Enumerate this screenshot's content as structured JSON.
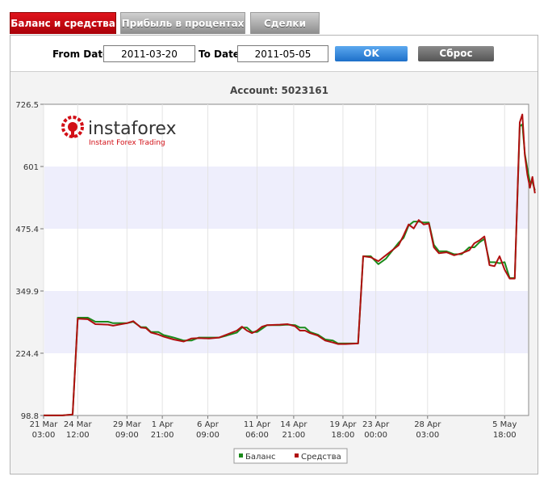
{
  "tabs": [
    {
      "label": "Баланс и средства",
      "active": true
    },
    {
      "label": "Прибыль в процентах",
      "active": false
    },
    {
      "label": "Сделки",
      "active": false
    }
  ],
  "filter": {
    "from_label": "From Date",
    "from_value": "2011-03-20",
    "to_label": "To Date",
    "to_value": "2011-05-05",
    "ok_label": "OK",
    "reset_label": "Сброс"
  },
  "logo": {
    "name": "instaforex",
    "tagline": "Instant Forex Trading"
  },
  "colors": {
    "balance": "#1a8a1a",
    "equity": "#b01010",
    "band": "#eeeefc",
    "accent": "#d20f16"
  },
  "chart_data": {
    "type": "line",
    "title": "Account: 5023161",
    "xlabel": "",
    "ylabel": "",
    "ylim": [
      98.8,
      726.5
    ],
    "yticks": [
      "98.8",
      "224.4",
      "349.9",
      "475.4",
      "601",
      "726.5"
    ],
    "xlim": [
      "2011-03-21 03:00",
      "2011-05-08 03:00"
    ],
    "xticks": [
      {
        "t": "2011-03-21 03:00",
        "label1": "21 Mar",
        "label2": "03:00"
      },
      {
        "t": "2011-03-24 12:00",
        "label1": "24 Mar",
        "label2": "12:00"
      },
      {
        "t": "2011-03-29 09:00",
        "label1": "29 Mar",
        "label2": "09:00"
      },
      {
        "t": "2011-04-01 21:00",
        "label1": "1 Apr",
        "label2": "21:00"
      },
      {
        "t": "2011-04-06 09:00",
        "label1": "6 Apr",
        "label2": "09:00"
      },
      {
        "t": "2011-04-11 06:00",
        "label1": "11 Apr",
        "label2": "06:00"
      },
      {
        "t": "2011-04-14 21:00",
        "label1": "14 Apr",
        "label2": "21:00"
      },
      {
        "t": "2011-04-19 18:00",
        "label1": "19 Apr",
        "label2": "18:00"
      },
      {
        "t": "2011-04-23 00:00",
        "label1": "23 Apr",
        "label2": "00:00"
      },
      {
        "t": "2011-04-28 03:00",
        "label1": "28 Apr",
        "label2": "03:00"
      },
      {
        "t": "2011-05-05 18:00",
        "label1": "5 May",
        "label2": "18:00"
      }
    ],
    "legend_position": "bottom-center",
    "grid": true,
    "series": [
      {
        "name": "Баланс",
        "points": [
          [
            "2011-03-21 03:00",
            99
          ],
          [
            "2011-03-23 00:00",
            99
          ],
          [
            "2011-03-24 00:00",
            101
          ],
          [
            "2011-03-24 12:00",
            296
          ],
          [
            "2011-03-25 12:00",
            296
          ],
          [
            "2011-03-26 06:00",
            288
          ],
          [
            "2011-03-27 12:00",
            288
          ],
          [
            "2011-03-28 00:00",
            285
          ],
          [
            "2011-03-29 09:00",
            285
          ],
          [
            "2011-03-30 00:00",
            288
          ],
          [
            "2011-03-30 18:00",
            277
          ],
          [
            "2011-03-31 06:00",
            277
          ],
          [
            "2011-03-31 18:00",
            267
          ],
          [
            "2011-04-01 12:00",
            267
          ],
          [
            "2011-04-02 00:00",
            261
          ],
          [
            "2011-04-03 00:00",
            256
          ],
          [
            "2011-04-04 00:00",
            250
          ],
          [
            "2011-04-04 18:00",
            250
          ],
          [
            "2011-04-05 12:00",
            256
          ],
          [
            "2011-04-06 12:00",
            256
          ],
          [
            "2011-04-07 12:00",
            256
          ],
          [
            "2011-04-08 06:00",
            260
          ],
          [
            "2011-04-09 06:00",
            266
          ],
          [
            "2011-04-09 18:00",
            276
          ],
          [
            "2011-04-10 06:00",
            276
          ],
          [
            "2011-04-10 18:00",
            267
          ],
          [
            "2011-04-11 06:00",
            267
          ],
          [
            "2011-04-11 18:00",
            274
          ],
          [
            "2011-04-12 06:00",
            281
          ],
          [
            "2011-04-13 12:00",
            281
          ],
          [
            "2011-04-14 06:00",
            282
          ],
          [
            "2011-04-15 00:00",
            281
          ],
          [
            "2011-04-15 12:00",
            276
          ],
          [
            "2011-04-16 00:00",
            276
          ],
          [
            "2011-04-16 12:00",
            267
          ],
          [
            "2011-04-17 06:00",
            262
          ],
          [
            "2011-04-18 00:00",
            252
          ],
          [
            "2011-04-18 18:00",
            250
          ],
          [
            "2011-04-19 06:00",
            244
          ],
          [
            "2011-04-20 00:00",
            244
          ],
          [
            "2011-04-21 06:00",
            244
          ],
          [
            "2011-04-21 18:00",
            420
          ],
          [
            "2011-04-22 12:00",
            420
          ],
          [
            "2011-04-23 06:00",
            404
          ],
          [
            "2011-04-24 00:00",
            415
          ],
          [
            "2011-04-25 06:00",
            447
          ],
          [
            "2011-04-25 18:00",
            457
          ],
          [
            "2011-04-26 06:00",
            482
          ],
          [
            "2011-04-26 18:00",
            490
          ],
          [
            "2011-04-27 06:00",
            490
          ],
          [
            "2011-04-27 18:00",
            488
          ],
          [
            "2011-04-28 06:00",
            488
          ],
          [
            "2011-04-28 18:00",
            443
          ],
          [
            "2011-04-29 06:00",
            430
          ],
          [
            "2011-04-30 00:00",
            430
          ],
          [
            "2011-04-30 18:00",
            424
          ],
          [
            "2011-05-01 12:00",
            424
          ],
          [
            "2011-05-02 06:00",
            438
          ],
          [
            "2011-05-02 18:00",
            438
          ],
          [
            "2011-05-03 06:00",
            448
          ],
          [
            "2011-05-03 18:00",
            455
          ],
          [
            "2011-05-04 06:00",
            408
          ],
          [
            "2011-05-04 18:00",
            408
          ],
          [
            "2011-05-05 06:00",
            406
          ],
          [
            "2011-05-05 18:00",
            408
          ],
          [
            "2011-05-06 06:00",
            376
          ],
          [
            "2011-05-06 18:00",
            376
          ],
          [
            "2011-05-07 06:00",
            682
          ],
          [
            "2011-05-07 12:00",
            686
          ],
          [
            "2011-05-07 18:00",
            627
          ],
          [
            "2011-05-08 00:00",
            597
          ],
          [
            "2011-05-08 06:00",
            569
          ],
          [
            "2011-05-08 12:00",
            570
          ],
          [
            "2011-05-08 18:00",
            553
          ]
        ]
      },
      {
        "name": "Средства",
        "points": [
          [
            "2011-03-21 03:00",
            99
          ],
          [
            "2011-03-23 00:00",
            99
          ],
          [
            "2011-03-24 00:00",
            101
          ],
          [
            "2011-03-24 12:00",
            294
          ],
          [
            "2011-03-25 12:00",
            293
          ],
          [
            "2011-03-26 06:00",
            283
          ],
          [
            "2011-03-27 12:00",
            282
          ],
          [
            "2011-03-28 00:00",
            280
          ],
          [
            "2011-03-29 09:00",
            285
          ],
          [
            "2011-03-30 00:00",
            289
          ],
          [
            "2011-03-30 18:00",
            276
          ],
          [
            "2011-03-31 06:00",
            275
          ],
          [
            "2011-03-31 18:00",
            266
          ],
          [
            "2011-04-01 12:00",
            262
          ],
          [
            "2011-04-02 00:00",
            258
          ],
          [
            "2011-04-03 00:00",
            252
          ],
          [
            "2011-04-04 00:00",
            248
          ],
          [
            "2011-04-04 18:00",
            254
          ],
          [
            "2011-04-05 12:00",
            255
          ],
          [
            "2011-04-06 12:00",
            254
          ],
          [
            "2011-04-07 12:00",
            256
          ],
          [
            "2011-04-08 06:00",
            262
          ],
          [
            "2011-04-09 06:00",
            270
          ],
          [
            "2011-04-09 18:00",
            278
          ],
          [
            "2011-04-10 06:00",
            270
          ],
          [
            "2011-04-10 18:00",
            265
          ],
          [
            "2011-04-11 06:00",
            270
          ],
          [
            "2011-04-11 18:00",
            278
          ],
          [
            "2011-04-12 06:00",
            281
          ],
          [
            "2011-04-13 12:00",
            282
          ],
          [
            "2011-04-14 06:00",
            283
          ],
          [
            "2011-04-15 00:00",
            279
          ],
          [
            "2011-04-15 12:00",
            270
          ],
          [
            "2011-04-16 00:00",
            270
          ],
          [
            "2011-04-16 12:00",
            265
          ],
          [
            "2011-04-17 06:00",
            260
          ],
          [
            "2011-04-18 00:00",
            250
          ],
          [
            "2011-04-18 18:00",
            246
          ],
          [
            "2011-04-19 06:00",
            243
          ],
          [
            "2011-04-20 00:00",
            243
          ],
          [
            "2011-04-21 06:00",
            244
          ],
          [
            "2011-04-21 18:00",
            420
          ],
          [
            "2011-04-22 12:00",
            418
          ],
          [
            "2011-04-23 06:00",
            410
          ],
          [
            "2011-04-24 00:00",
            422
          ],
          [
            "2011-04-25 06:00",
            442
          ],
          [
            "2011-04-25 18:00",
            462
          ],
          [
            "2011-04-26 06:00",
            484
          ],
          [
            "2011-04-26 18:00",
            476
          ],
          [
            "2011-04-27 06:00",
            493
          ],
          [
            "2011-04-27 18:00",
            484
          ],
          [
            "2011-04-28 06:00",
            486
          ],
          [
            "2011-04-28 18:00",
            438
          ],
          [
            "2011-04-29 06:00",
            426
          ],
          [
            "2011-04-30 00:00",
            428
          ],
          [
            "2011-04-30 18:00",
            422
          ],
          [
            "2011-05-01 12:00",
            426
          ],
          [
            "2011-05-02 06:00",
            432
          ],
          [
            "2011-05-02 18:00",
            446
          ],
          [
            "2011-05-03 06:00",
            452
          ],
          [
            "2011-05-03 18:00",
            460
          ],
          [
            "2011-05-04 06:00",
            402
          ],
          [
            "2011-05-04 18:00",
            400
          ],
          [
            "2011-05-05 06:00",
            420
          ],
          [
            "2011-05-05 18:00",
            393
          ],
          [
            "2011-05-06 06:00",
            375
          ],
          [
            "2011-05-06 18:00",
            375
          ],
          [
            "2011-05-07 06:00",
            690
          ],
          [
            "2011-05-07 12:00",
            706
          ],
          [
            "2011-05-07 18:00",
            624
          ],
          [
            "2011-05-08 00:00",
            585
          ],
          [
            "2011-05-08 06:00",
            558
          ],
          [
            "2011-05-08 12:00",
            580
          ],
          [
            "2011-05-08 18:00",
            547
          ]
        ]
      }
    ]
  }
}
